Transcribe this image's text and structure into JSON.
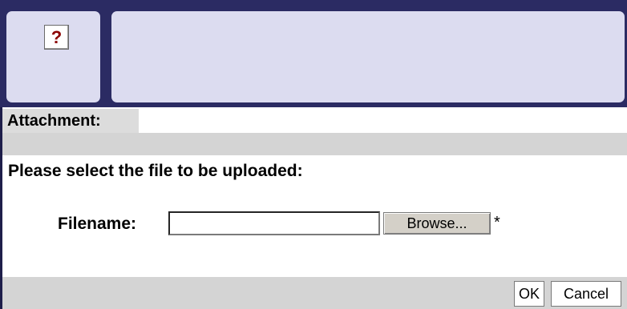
{
  "header": {
    "help_icon_glyph": "?",
    "help_icon": "help-icon"
  },
  "attachment": {
    "label": "Attachment:"
  },
  "upload": {
    "prompt": "Please select the file to be uploaded:",
    "filename_label": "Filename:",
    "filename_value": "",
    "browse_label": "Browse...",
    "required_mark": "*"
  },
  "actions": {
    "ok_label": "OK",
    "cancel_label": "Cancel"
  },
  "colors": {
    "header_bg": "#2b2b63",
    "panel_bg": "#dcdcf0",
    "band_gray": "#d4d4d4"
  }
}
